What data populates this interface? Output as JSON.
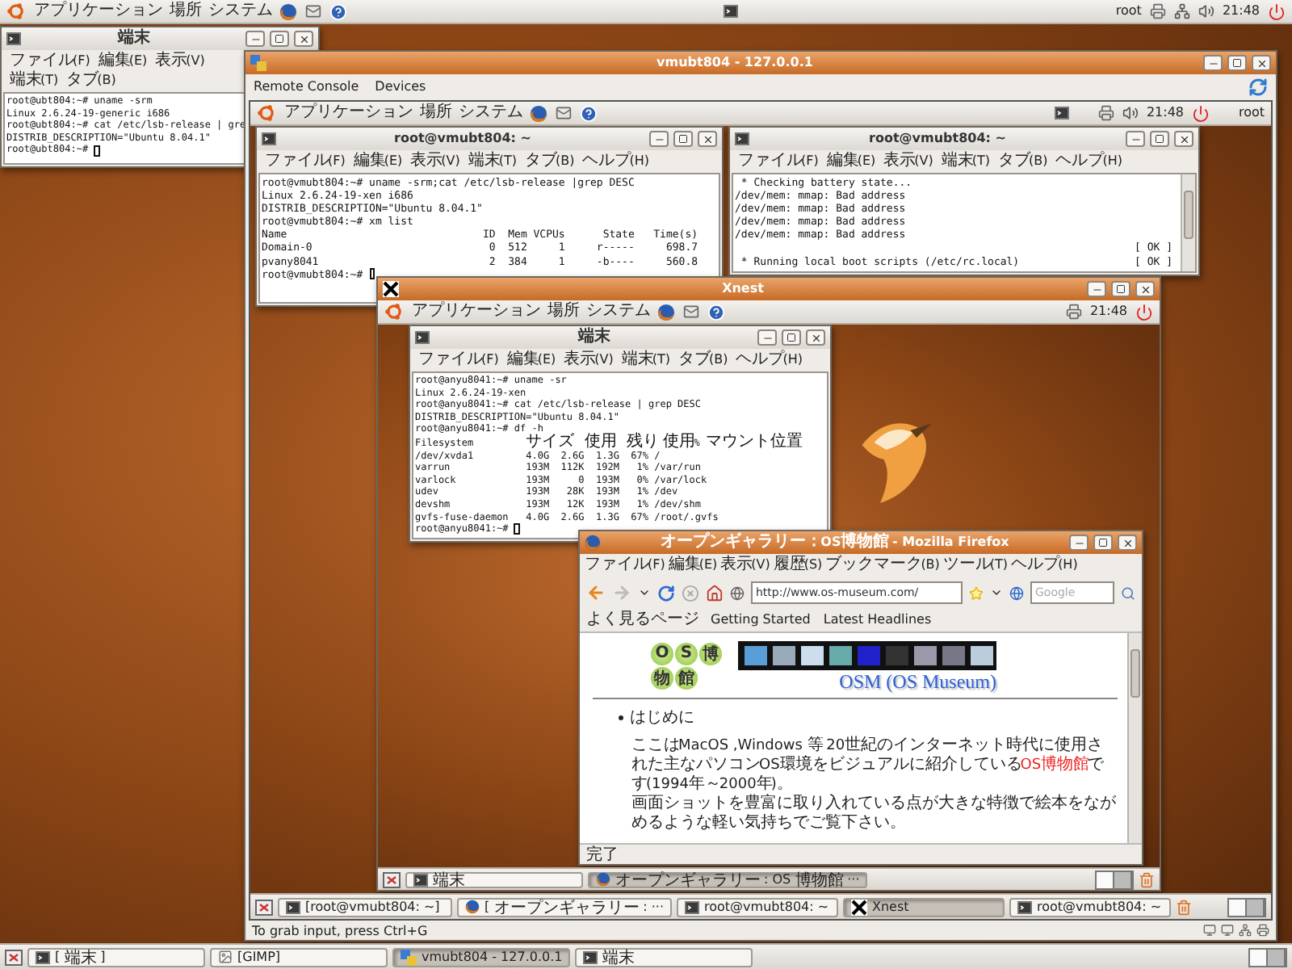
{
  "top_panel": {
    "menus": [
      "アプリケーション",
      "場所",
      "システム"
    ],
    "user": "root",
    "clock": "21:48"
  },
  "host_terminal": {
    "title": "端末",
    "active": false,
    "menus": [
      "ファイル(F)",
      "編集(E)",
      "表示(V)",
      "端末(T)",
      "タブ(B)"
    ],
    "cursor": true,
    "lines": [
      {
        "text": "root@ubt804:~# uname -srm"
      },
      {
        "text": "Linux 2.6.24-19-generic i686"
      },
      {
        "text": "root@ubt804:~# cat /etc/lsb-release | gre"
      },
      {
        "text": "DISTRIB_DESCRIPTION=\"Ubuntu 8.04.1\""
      },
      {
        "text": "root@ubt804:~# "
      }
    ]
  },
  "vm_window": {
    "title": "vmubt804 - 127.0.0.1",
    "active": true,
    "menus": [
      "Remote Console",
      "Devices"
    ],
    "status": "To grab input, press Ctrl+G"
  },
  "guest_panel": {
    "menus": [
      "アプリケーション",
      "場所",
      "システム"
    ],
    "clock": "21:48",
    "user": "root"
  },
  "guest_terminal_1": {
    "title": "root@vmubt804: ~",
    "active": false,
    "menus": [
      "ファイル(F)",
      "編集(E)",
      "表示(V)",
      "端末(T)",
      "タブ(B)",
      "ヘルプ(H)"
    ],
    "cursor": true,
    "lines": [
      {
        "text": "root@vmubt804:~# uname -srm;cat /etc/lsb-release |grep DESC"
      },
      {
        "text": "Linux 2.6.24-19-xen i686"
      },
      {
        "text": "DISTRIB_DESCRIPTION=\"Ubuntu 8.04.1\""
      },
      {
        "text": "root@vmubt804:~# xm list"
      },
      {
        "text": "Name                               ID  Mem VCPUs      State   Time(s)"
      },
      {
        "text": "Domain-0                            0  512     1     r-----     698.7"
      },
      {
        "text": "pvany8041                           2  384     1     -b----     560.8"
      },
      {
        "text": "root@vmubt804:~# "
      }
    ]
  },
  "guest_terminal_2": {
    "title": "root@vmubt804: ~",
    "active": false,
    "menus": [
      "ファイル(F)",
      "編集(E)",
      "表示(V)",
      "端末(T)",
      "タブ(B)",
      "ヘルプ(H)"
    ],
    "lines": [
      {
        "text": " * Checking battery state..."
      },
      {
        "text": "/dev/mem: mmap: Bad address"
      },
      {
        "text": "/dev/mem: mmap: Bad address"
      },
      {
        "text": "/dev/mem: mmap: Bad address"
      },
      {
        "text": "/dev/mem: mmap: Bad address"
      },
      {
        "status": "[ OK ]"
      },
      {
        "text": " * Running local boot scripts (/etc/rc.local)",
        "status": "[ OK ]"
      }
    ]
  },
  "xnest": {
    "title": "Xnest",
    "active": true,
    "panel": {
      "menus": [
        "アプリケーション",
        "場所",
        "システム"
      ],
      "clock": "21:48"
    },
    "terminal": {
      "title": "端末",
      "active": false,
      "menus": [
        "ファイル(F)",
        "編集(E)",
        "表示(V)",
        "端末(T)",
        "タブ(B)",
        "ヘルプ(H)"
      ],
      "cursor": true,
      "lines": [
        {
          "text": "root@anyu8041:~# uname -sr"
        },
        {
          "text": "Linux 2.6.24-19-xen"
        },
        {
          "text": "root@anyu8041:~# cat /etc/lsb-release | grep DESC"
        },
        {
          "text": "DISTRIB_DESCRIPTION=\"Ubuntu 8.04.1\""
        },
        {
          "text": "root@anyu8041:~# df -h"
        },
        {
          "text": "Filesystem         サイズ  使用  残り 使用% マウント位置"
        },
        {
          "text": "/dev/xvda1         4.0G  2.6G  1.3G  67% /"
        },
        {
          "text": "varrun             193M  112K  192M   1% /var/run"
        },
        {
          "text": "varlock            193M     0  193M   0% /var/lock"
        },
        {
          "text": "udev               193M   28K  193M   1% /dev"
        },
        {
          "text": "devshm             193M   12K  193M   1% /dev/shm"
        },
        {
          "text": "gvfs-fuse-daemon   4.0G  2.6G  1.3G  67% /root/.gvfs"
        },
        {
          "text": "root@anyu8041:~# "
        }
      ]
    },
    "firefox": {
      "title": "オープンギャラリー：OS博物館 - Mozilla Firefox",
      "active": true,
      "menus": [
        "ファイル(F)",
        "編集(E)",
        "表示(V)",
        "履歴(S)",
        "ブックマーク(B)",
        "ツール(T)",
        "ヘルプ(H)"
      ],
      "url": "http://www.os-museum.com/",
      "search_placeholder": "Google",
      "bookmarks": [
        "よく見るページ",
        "Getting Started",
        "Latest Headlines"
      ],
      "page": {
        "logo": [
          "O",
          "S",
          "博",
          "物",
          "館"
        ],
        "heading": "OSM (OS Museum)",
        "bullet": "はじめに",
        "intro": {
          "before": "ここはMacOS ,Windows 等 20世紀のインターネット時代に使用された主なパソコンOS環境をビジュアルに紹介している",
          "link": "OS博物館",
          "after": "です(1994年～2000年)。"
        },
        "note": "画面ショットを豊富に取り入れている点が大きな特徴で絵本をながめるような軽い気持ちでご覧下さい。"
      },
      "status": "完了"
    },
    "taskbar": [
      {
        "label": "端末",
        "kind": "terminal",
        "selected": false
      },
      {
        "label": "オープンギャラリー : OS博物館 ···",
        "kind": "browser",
        "selected": true
      }
    ]
  },
  "guest_taskbar": [
    {
      "label": "[root@vmubt804: ~]",
      "kind": "terminal",
      "selected": false
    },
    {
      "label": "[オープンギャラリー : ···",
      "kind": "browser",
      "selected": false
    },
    {
      "label": "root@vmubt804: ~",
      "kind": "terminal",
      "selected": false
    },
    {
      "label": "Xnest",
      "kind": "xnest",
      "selected": true
    },
    {
      "label": "root@vmubt804: ~",
      "kind": "terminal",
      "selected": false
    }
  ],
  "host_taskbar": [
    {
      "label": "[端末]",
      "kind": "terminal",
      "selected": false
    },
    {
      "label": "[GIMP]",
      "kind": "image",
      "selected": false
    },
    {
      "label": "vmubt804 - 127.0.0.1",
      "kind": "vm",
      "selected": true
    },
    {
      "label": "端末",
      "kind": "terminal",
      "selected": false
    }
  ]
}
